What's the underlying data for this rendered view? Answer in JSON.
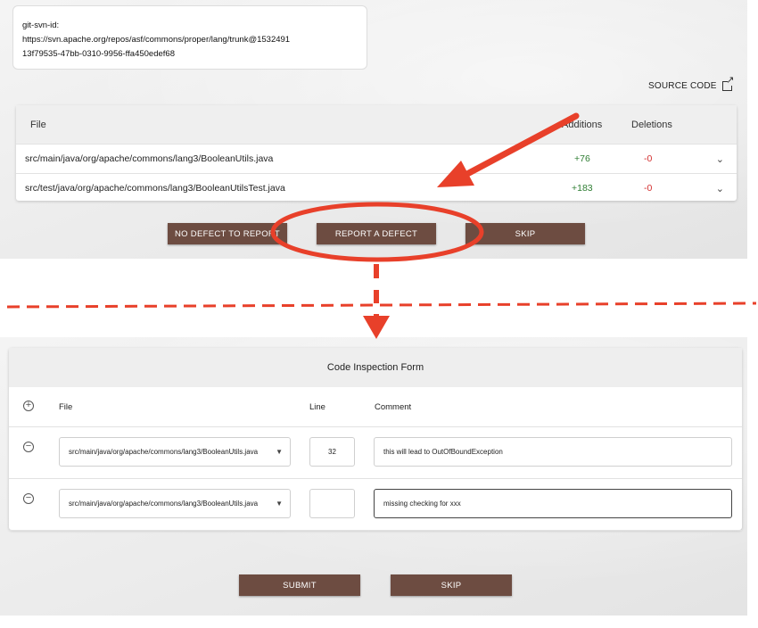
{
  "commit": {
    "line1": "git-svn-id:",
    "line2": "https://svn.apache.org/repos/asf/commons/proper/lang/trunk@1532491",
    "line3": "13f79535-47bb-0310-9956-ffa450edef68"
  },
  "source_code_label": "SOURCE CODE",
  "file_table": {
    "headers": {
      "file": "File",
      "additions": "Additions",
      "deletions": "Deletions"
    },
    "rows": [
      {
        "file": "src/main/java/org/apache/commons/lang3/BooleanUtils.java",
        "additions": "+76",
        "deletions": "-0"
      },
      {
        "file": "src/test/java/org/apache/commons/lang3/BooleanUtilsTest.java",
        "additions": "+183",
        "deletions": "-0"
      }
    ]
  },
  "actions": {
    "no_defect": "NO DEFECT TO REPORT",
    "report_defect": "REPORT A DEFECT",
    "skip": "SKIP"
  },
  "form": {
    "title": "Code Inspection Form",
    "headers": {
      "file": "File",
      "line": "Line",
      "comment": "Comment"
    },
    "rows": [
      {
        "file": "src/main/java/org/apache/commons/lang3/BooleanUtils.java",
        "line": "32",
        "comment": "this will lead to OutOfBoundException"
      },
      {
        "file": "src/main/java/org/apache/commons/lang3/BooleanUtils.java",
        "line": "",
        "comment": "missing checking for xxx"
      }
    ],
    "submit": "SUBMIT",
    "skip": "SKIP"
  },
  "colors": {
    "button": "#6d4c41",
    "annotation": "#e8402a",
    "additions": "#2e7d32",
    "deletions": "#d32f2f"
  },
  "icons": [
    "external-link-icon",
    "chevron-down-icon",
    "add-circle-icon",
    "remove-circle-icon",
    "dropdown-caret-icon"
  ]
}
